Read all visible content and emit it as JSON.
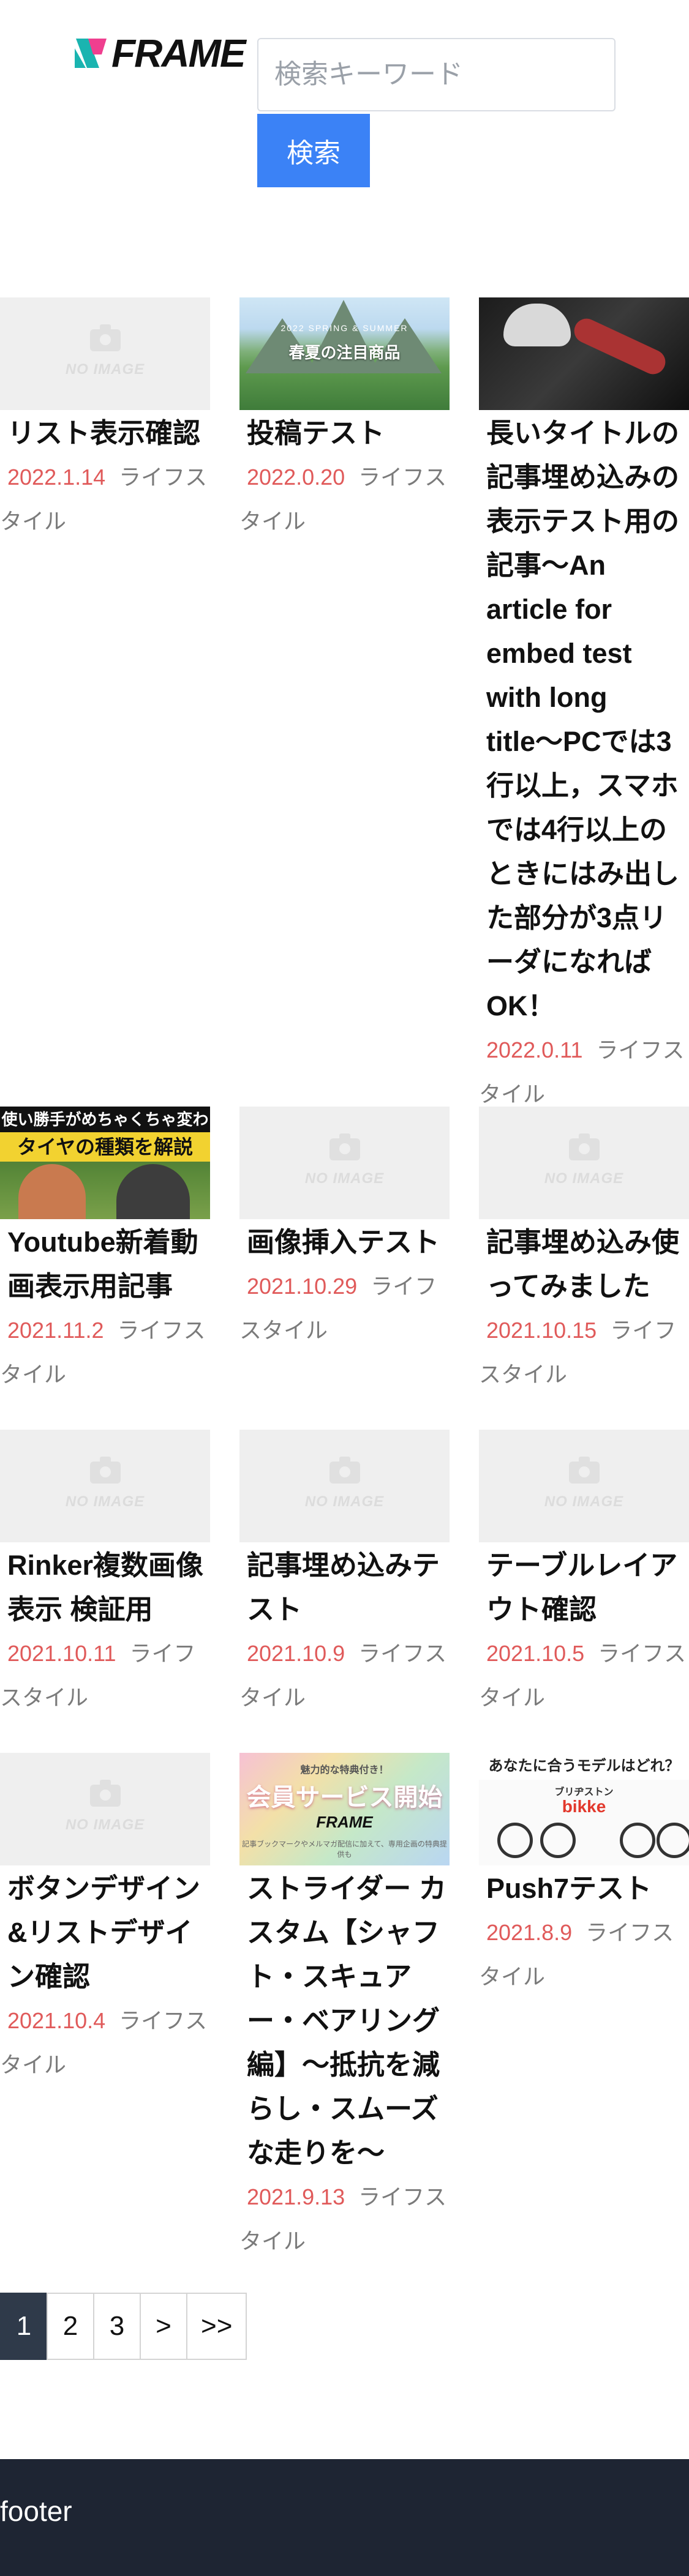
{
  "header": {
    "logo_text": "FRAME",
    "search_placeholder": "検索キーワード",
    "search_button_label": "検索"
  },
  "colors": {
    "accent": "#3b82f6",
    "date_color": "#e05a5a",
    "footer_bg": "#1e2533",
    "logo_pink": "#ef3f8f",
    "logo_teal": "#1ab4b0"
  },
  "no_image_label": "NO IMAGE",
  "posts": [
    {
      "title": "リスト表示確認",
      "date": "2022.1.14",
      "category": "ライフスタイル",
      "thumbnail": "no-image"
    },
    {
      "title": "投稿テスト",
      "date": "2022.0.20",
      "category": "ライフスタイル",
      "thumbnail": "mountain-photo"
    },
    {
      "title": "長いタイトルの記事埋め込みの表示テスト用の記事〜An article for embed test with long title〜PCでは3行以上，スマホでは4行以上のときにはみ出した部分が3点リーダになればOK！",
      "date": "2022.0.11",
      "category": "ライフスタイル",
      "thumbnail": "cycling-photo"
    },
    {
      "title": "Youtube新着動画表示用記事",
      "date": "2021.11.2",
      "category": "ライフスタイル",
      "thumbnail": "tire-video-thumbnail"
    },
    {
      "title": "画像挿入テスト",
      "date": "2021.10.29",
      "category": "ライフスタイル",
      "thumbnail": "no-image"
    },
    {
      "title": "記事埋め込み使ってみました",
      "date": "2021.10.15",
      "category": "ライフスタイル",
      "thumbnail": "no-image"
    },
    {
      "title": "Rinker複数画像表示 検証用",
      "date": "2021.10.11",
      "category": "ライフスタイル",
      "thumbnail": "no-image"
    },
    {
      "title": "記事埋め込みテスト",
      "date": "2021.10.9",
      "category": "ライフスタイル",
      "thumbnail": "no-image"
    },
    {
      "title": "テーブルレイアウト確認",
      "date": "2021.10.5",
      "category": "ライフスタイル",
      "thumbnail": "no-image"
    },
    {
      "title": "ボタンデザイン&リストデザイン確認",
      "date": "2021.10.4",
      "category": "ライフスタイル",
      "thumbnail": "no-image"
    },
    {
      "title": "ストライダー カスタム【シャフト・スキュアー・ベアリング編】〜抵抗を減らし・スムーズな走りを〜",
      "date": "2021.9.13",
      "category": "ライフスタイル",
      "thumbnail": "member-service-banner"
    },
    {
      "title": "Push7テスト",
      "date": "2021.8.9",
      "category": "ライフスタイル",
      "thumbnail": "bicycle-banner"
    }
  ],
  "thumbnails": {
    "mountain": {
      "small_text": "2022 SPRING & SUMMER",
      "caption": "春夏の注目商品"
    },
    "tire": {
      "banner_top": "使い勝手がめちゃくちゃ変わる",
      "banner_main": "タイヤの種類を解説"
    },
    "member": {
      "top": "魅力的な特典付き！",
      "main": "会員サービス開始",
      "brand": "FRAME",
      "sub": "記事ブックマークやメルマガ配信に加えて、専用企画の特典提供も"
    },
    "push": {
      "band": "あなたに合うモデルはどれ？",
      "brand": "ブリヂストン",
      "model": "bikke"
    }
  },
  "pagination": {
    "pages": [
      "1",
      "2",
      "3",
      ">",
      ">>"
    ],
    "current": "1"
  },
  "footer": {
    "text": "footer"
  }
}
